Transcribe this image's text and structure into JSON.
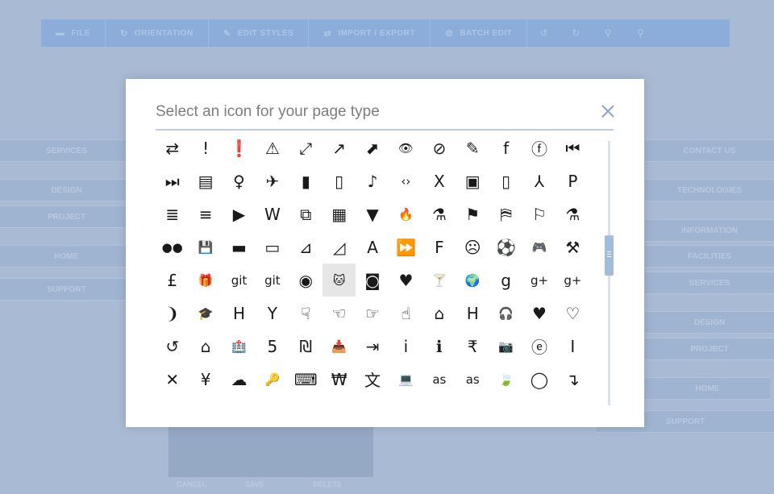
{
  "toolbar": {
    "items": [
      {
        "label": "FILE",
        "icon": "folder-icon"
      },
      {
        "label": "ORIENTATION",
        "icon": "rotate-icon"
      },
      {
        "label": "EDIT STYLES",
        "icon": "pencil-icon"
      },
      {
        "label": "IMPORT / EXPORT",
        "icon": "transfer-icon"
      },
      {
        "label": "BATCH EDIT",
        "icon": "cogs-icon"
      }
    ],
    "tool_icons": [
      "undo-icon",
      "redo-icon",
      "zoom-in-icon",
      "zoom-out-icon"
    ]
  },
  "background": {
    "left_nodes": [
      "SERVICES",
      "DESIGN",
      "PROJECT",
      "HOME",
      "SUPPORT"
    ],
    "right_nodes": [
      "CONTACT US",
      "TECHNOLOGIES",
      "INFORMATION",
      "FACILITIES",
      "SERVICES",
      "DESIGN",
      "PROJECT",
      "HOME",
      "SUPPORT"
    ],
    "panel_actions": [
      "CANCEL",
      "SAVE",
      "DELETE"
    ]
  },
  "modal": {
    "title": "Select an icon for your page type",
    "selected_icon": "github-alt-icon",
    "icons": [
      {
        "name": "exchange-icon",
        "glyph": "⇄"
      },
      {
        "name": "exclamation-icon",
        "glyph": "!"
      },
      {
        "name": "exclamation-circle-icon",
        "glyph": "❗"
      },
      {
        "name": "warning-icon",
        "glyph": "⚠"
      },
      {
        "name": "expand-icon",
        "glyph": "⤢"
      },
      {
        "name": "external-link-icon",
        "glyph": "↗"
      },
      {
        "name": "external-link-square-icon",
        "glyph": "⬈"
      },
      {
        "name": "eye-icon",
        "glyph": "👁"
      },
      {
        "name": "eye-slash-icon",
        "glyph": "⊘"
      },
      {
        "name": "eyedropper-icon",
        "glyph": "✎"
      },
      {
        "name": "facebook-icon",
        "glyph": "f"
      },
      {
        "name": "facebook-square-icon",
        "glyph": "ⓕ"
      },
      {
        "name": "fast-backward-icon",
        "glyph": "⏮"
      },
      {
        "name": "fast-forward-icon",
        "glyph": "⏭"
      },
      {
        "name": "fax-icon",
        "glyph": "▤"
      },
      {
        "name": "female-icon",
        "glyph": "♀"
      },
      {
        "name": "fighter-jet-icon",
        "glyph": "✈"
      },
      {
        "name": "file-icon",
        "glyph": "▮"
      },
      {
        "name": "file-archive-icon",
        "glyph": "▯"
      },
      {
        "name": "file-audio-icon",
        "glyph": "♪"
      },
      {
        "name": "file-code-icon",
        "glyph": "‹›"
      },
      {
        "name": "file-excel-icon",
        "glyph": "X"
      },
      {
        "name": "file-image-icon",
        "glyph": "▣"
      },
      {
        "name": "file-o-icon",
        "glyph": "▯"
      },
      {
        "name": "file-pdf-icon",
        "glyph": "⅄"
      },
      {
        "name": "file-powerpoint-icon",
        "glyph": "P"
      },
      {
        "name": "file-text-icon",
        "glyph": "≣"
      },
      {
        "name": "file-text-o-icon",
        "glyph": "≡"
      },
      {
        "name": "file-video-icon",
        "glyph": "▶"
      },
      {
        "name": "file-word-icon",
        "glyph": "W"
      },
      {
        "name": "files-icon",
        "glyph": "⧉"
      },
      {
        "name": "film-icon",
        "glyph": "▦"
      },
      {
        "name": "filter-icon",
        "glyph": "▼"
      },
      {
        "name": "fire-icon",
        "glyph": "🔥"
      },
      {
        "name": "fire-extinguisher-icon",
        "glyph": "⚗"
      },
      {
        "name": "flag-icon",
        "glyph": "⚑"
      },
      {
        "name": "flag-checkered-icon",
        "glyph": "⛿"
      },
      {
        "name": "flag-o-icon",
        "glyph": "⚐"
      },
      {
        "name": "flask-icon",
        "glyph": "⚗"
      },
      {
        "name": "flickr-icon",
        "glyph": "●●"
      },
      {
        "name": "floppy-icon",
        "glyph": "💾"
      },
      {
        "name": "folder-icon",
        "glyph": "▬"
      },
      {
        "name": "folder-o-icon",
        "glyph": "▭"
      },
      {
        "name": "folder-open-icon",
        "glyph": "⊿"
      },
      {
        "name": "folder-open-o-icon",
        "glyph": "◿"
      },
      {
        "name": "font-icon",
        "glyph": "A"
      },
      {
        "name": "forward-icon",
        "glyph": "⏩"
      },
      {
        "name": "foursquare-icon",
        "glyph": "F"
      },
      {
        "name": "frown-icon",
        "glyph": "☹"
      },
      {
        "name": "futbol-icon",
        "glyph": "⚽"
      },
      {
        "name": "gamepad-icon",
        "glyph": "🎮"
      },
      {
        "name": "gavel-icon",
        "glyph": "⚒"
      },
      {
        "name": "gbp-icon",
        "glyph": "£"
      },
      {
        "name": "gift-icon",
        "glyph": "🎁"
      },
      {
        "name": "git-icon",
        "glyph": "git"
      },
      {
        "name": "git-square-icon",
        "glyph": "git"
      },
      {
        "name": "github-icon",
        "glyph": "◉"
      },
      {
        "name": "github-alt-icon",
        "glyph": "🐱"
      },
      {
        "name": "github-square-icon",
        "glyph": "◙"
      },
      {
        "name": "gittip-icon",
        "glyph": "♥"
      },
      {
        "name": "glass-icon",
        "glyph": "🍸"
      },
      {
        "name": "globe-icon",
        "glyph": "🌍"
      },
      {
        "name": "google-icon",
        "glyph": "g"
      },
      {
        "name": "google-plus-icon",
        "glyph": "g+"
      },
      {
        "name": "google-plus-square-icon",
        "glyph": "g+"
      },
      {
        "name": "wifi-signal-icon",
        "glyph": "❩"
      },
      {
        "name": "graduation-cap-icon",
        "glyph": "🎓"
      },
      {
        "name": "hacker-news-icon",
        "glyph": "H"
      },
      {
        "name": "y-combinator-icon",
        "glyph": "Y"
      },
      {
        "name": "hand-o-down-icon",
        "glyph": "☟"
      },
      {
        "name": "hand-o-left-icon",
        "glyph": "☜"
      },
      {
        "name": "hand-o-right-icon",
        "glyph": "☞"
      },
      {
        "name": "hand-o-up-icon",
        "glyph": "☝"
      },
      {
        "name": "hdd-icon",
        "glyph": "⌂"
      },
      {
        "name": "header-icon",
        "glyph": "H"
      },
      {
        "name": "headphones-icon",
        "glyph": "🎧"
      },
      {
        "name": "heart-icon",
        "glyph": "♥"
      },
      {
        "name": "heart-o-icon",
        "glyph": "♡"
      },
      {
        "name": "history-icon",
        "glyph": "↺"
      },
      {
        "name": "home-icon",
        "glyph": "⌂"
      },
      {
        "name": "hospital-icon",
        "glyph": "🏥"
      },
      {
        "name": "html5-icon",
        "glyph": "5"
      },
      {
        "name": "ils-icon",
        "glyph": "₪"
      },
      {
        "name": "inbox-icon",
        "glyph": "📥"
      },
      {
        "name": "indent-icon",
        "glyph": "⇥"
      },
      {
        "name": "info-icon",
        "glyph": "i"
      },
      {
        "name": "info-circle-icon",
        "glyph": "ℹ"
      },
      {
        "name": "inr-icon",
        "glyph": "₹"
      },
      {
        "name": "instagram-icon",
        "glyph": "📷"
      },
      {
        "name": "internet-explorer-icon",
        "glyph": "ⓔ"
      },
      {
        "name": "italic-icon",
        "glyph": "I"
      },
      {
        "name": "joomla-icon",
        "glyph": "✕"
      },
      {
        "name": "jpy-icon",
        "glyph": "¥"
      },
      {
        "name": "jsfiddle-icon",
        "glyph": "☁"
      },
      {
        "name": "key-icon",
        "glyph": "🔑"
      },
      {
        "name": "keyboard-icon",
        "glyph": "⌨"
      },
      {
        "name": "krw-icon",
        "glyph": "₩"
      },
      {
        "name": "language-icon",
        "glyph": "文"
      },
      {
        "name": "laptop-icon",
        "glyph": "💻"
      },
      {
        "name": "lastfm-icon",
        "glyph": "as"
      },
      {
        "name": "lastfm-square-icon",
        "glyph": "as"
      },
      {
        "name": "leaf-icon",
        "glyph": "🍃"
      },
      {
        "name": "lemon-icon",
        "glyph": "◯"
      },
      {
        "name": "level-down-icon",
        "glyph": "↴"
      }
    ]
  }
}
